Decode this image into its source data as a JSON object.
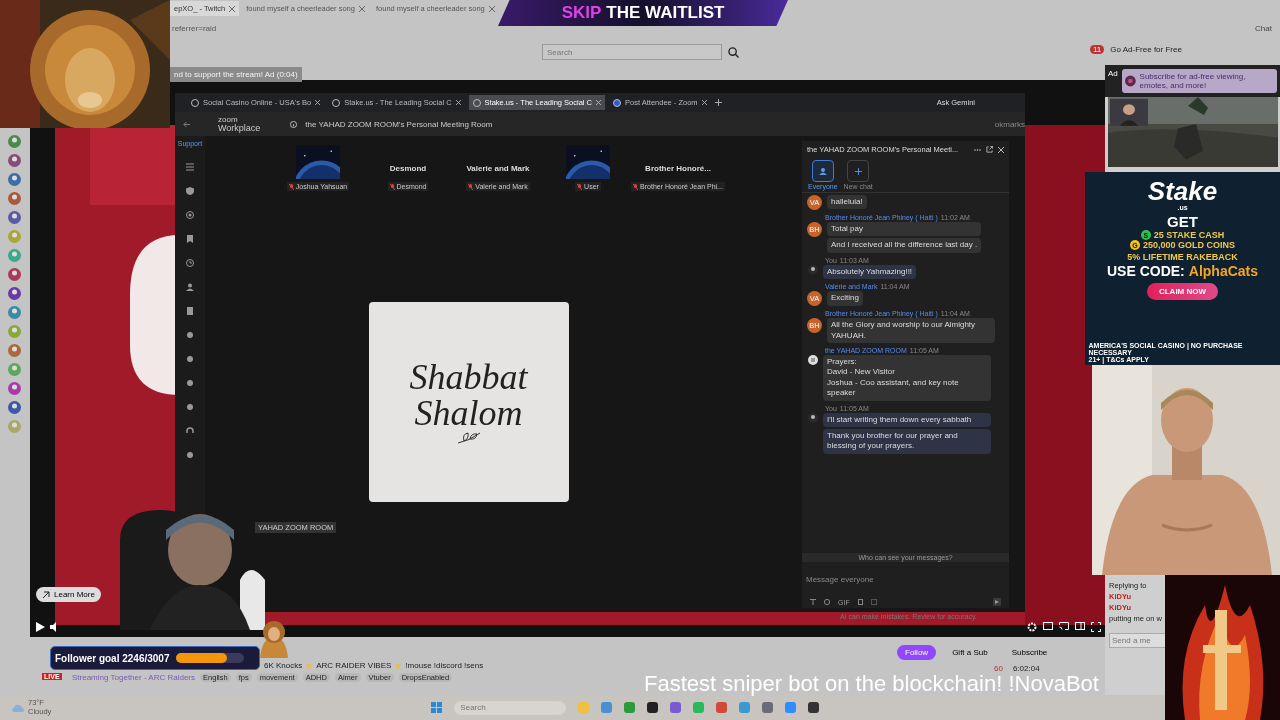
{
  "browser": {
    "tabs": [
      {
        "label": "epXO_ - Twitch",
        "selected": true
      },
      {
        "label": "found myself a cheerleader song",
        "selected": false
      },
      {
        "label": "found myself a cheerleader song",
        "selected": false
      }
    ],
    "address": "referrer=raid",
    "search": {
      "placeholder": "Search"
    },
    "notification_count": "11",
    "ad_free": "Go Ad-Free for Free",
    "chat_button": "Chat"
  },
  "promo_banner": {
    "highlight": "SKIP",
    "text": "THE WAITLIST"
  },
  "ad_notice": "nd to support the stream! Ad (0:04)",
  "player": {
    "learn_more": "Learn More"
  },
  "zoom_window": {
    "tabs": [
      {
        "label": "Social Casino Online - USA's Bo",
        "selected": false
      },
      {
        "label": "Stake.us - The Leading Social C",
        "selected": false
      },
      {
        "label": "Stake.us - The Leading Social C",
        "selected": true
      },
      {
        "label": "Post Attendee - Zoom",
        "selected": false
      }
    ],
    "ask": "Ask Gemini",
    "brand_top": "zoom",
    "brand": "Workplace",
    "meeting_title": "the YAHAD ZOOM ROOM's Personal Meeting Room",
    "bookmarks": "okmarks",
    "support": "Support",
    "participants": [
      {
        "kind": "video",
        "label": "Joshua Yahsuan"
      },
      {
        "kind": "name",
        "title": "Desmond",
        "label": "Desmond"
      },
      {
        "kind": "name",
        "title": "Valerie and Mark",
        "label": "Valerie and Mark"
      },
      {
        "kind": "video",
        "label": "User"
      },
      {
        "kind": "name",
        "title": "Brother Honoré...",
        "label": "Brother Honoré Jean Phi..."
      }
    ],
    "shared_screen": {
      "line1": "Shabbat",
      "line2": "Shalom"
    },
    "host_label": "YAHAD ZOOM ROOM",
    "disclaimer": "AI can make mistakes. Review for accuracy.",
    "chat": {
      "title": "the YAHAD ZOOM ROOM's Personal Meeti...",
      "channels": [
        {
          "label": "Everyone",
          "selected": true
        },
        {
          "label": "New chat",
          "selected": false
        }
      ],
      "groups": [
        {
          "kind": "initials",
          "initials": "VA",
          "own": false,
          "messages": [
            "halleluia!"
          ]
        },
        {
          "sender": "Brother Honoré Jean Phiney ( Haiti )",
          "time": "11:02 AM",
          "kind": "initials",
          "initials": "BH",
          "own": false,
          "messages": [
            "Total pay",
            "And I received all the difference last day ."
          ]
        },
        {
          "sender": "You",
          "time": "11:03 AM",
          "own": true,
          "messages": [
            "Absolutely Yahmazing!!!"
          ]
        },
        {
          "sender": "Valerie and Mark",
          "time": "11:04 AM",
          "kind": "initials",
          "initials": "VA",
          "own": false,
          "messages": [
            "Exciting"
          ]
        },
        {
          "sender": "Brother Honoré Jean Phiney ( Haiti )",
          "time": "11:04 AM",
          "kind": "initials",
          "initials": "BH",
          "own": false,
          "messages": [
            "All the Glory and worship to our Almighty YAHUAH."
          ]
        },
        {
          "sender": "the YAHAD ZOOM ROOM",
          "time": "11:05 AM",
          "kind": "logo",
          "own": false,
          "messages": [
            "Prayers:\nDavid - New Visitor\nJoshua - Coo assistant, and key note speaker"
          ]
        },
        {
          "sender": "You",
          "time": "11:05 AM",
          "own": true,
          "messages": [
            "I'll start writing them down every sabbath",
            "Thank you brother for our prayer and blessing of your prayers."
          ]
        }
      ],
      "who_can_see": "Who can see your messages?",
      "input": {
        "placeholder": "Message everyone"
      },
      "gif": "GIF"
    }
  },
  "stream_info": {
    "follower_goal": {
      "label": "Follower goal 2246/3007",
      "level": 0.75
    },
    "live": "LIVE",
    "title_parts": [
      "6K Knocks",
      "ARC RAIDER VIBES",
      "!mouse !discord !sens"
    ],
    "together": "Streaming Together - ARC Raiders",
    "tags": [
      "English",
      "fps",
      "movement",
      "ADHD",
      "Aimer",
      "Vtuber",
      "DropsEnabled"
    ],
    "follow": "Follow",
    "gift": "Gift a Sub",
    "subscribe": "Subscribe",
    "viewers": "60",
    "uptime": "6:02:04"
  },
  "overlay_text": "Fastest sniper bot on the blockchain! !NovaBot",
  "side_chat": {
    "ad": "Ad",
    "subscribe_promo": "Subscribe for ad-free viewing, emotes, and more!",
    "replying": "Replying to",
    "users": [
      "KiDYu",
      "KiDYu"
    ],
    "message": "putting me on w",
    "input": {
      "placeholder": "Send a me"
    }
  },
  "stake_ad": {
    "brand": "Stake",
    "domain": ".us",
    "get": "GET",
    "offers": [
      {
        "coin": "S",
        "text": "25 STAKE CASH",
        "color": "#2fc24a"
      },
      {
        "coin": "G",
        "text": "250,000 GOLD COINS",
        "color": "#f2c40f"
      }
    ],
    "rakeback": "5% LIFETIME RAKEBACK",
    "code_label": "USE CODE:",
    "code": "AlphaCats",
    "cta": "CLAIM NOW",
    "footer_left": "AMERICA'S SOCIAL CASINO | NO PURCHASE NECESSARY",
    "footer_right": "21+ | T&Cs APPLY"
  },
  "taskbar": {
    "temperature": "73°F",
    "weather": "Cloudy",
    "search": {
      "placeholder": "Search"
    }
  }
}
